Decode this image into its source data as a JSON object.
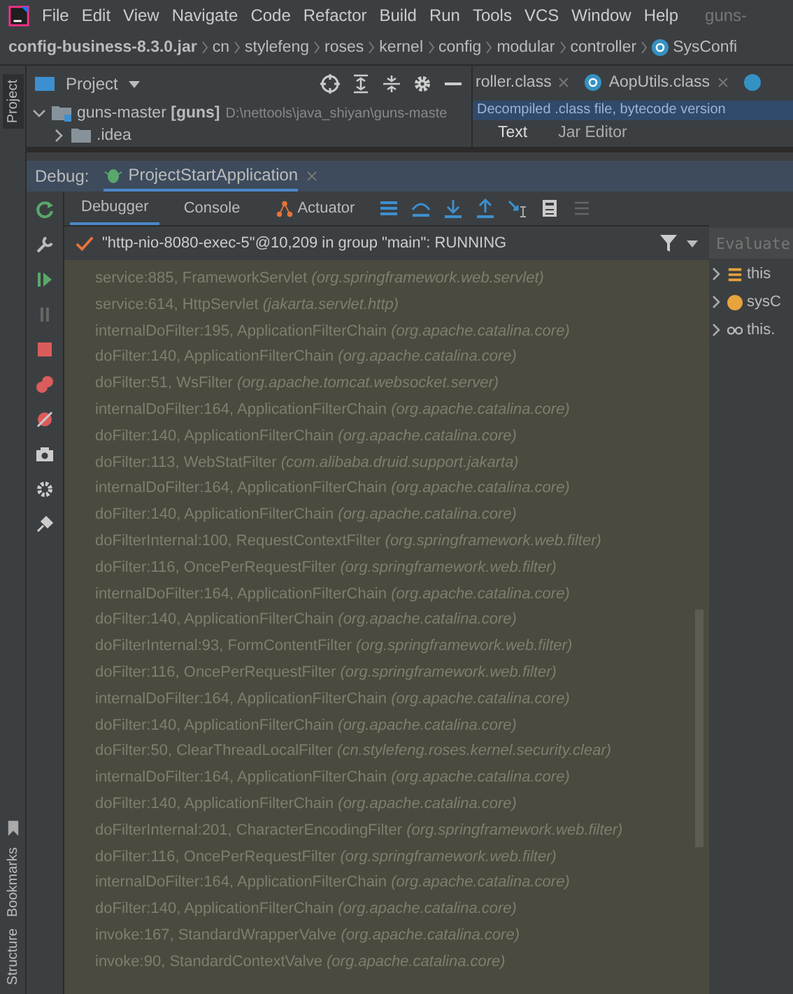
{
  "menu_bar": {
    "items": [
      "File",
      "Edit",
      "View",
      "Navigate",
      "Code",
      "Refactor",
      "Build",
      "Run",
      "Tools",
      "VCS",
      "Window",
      "Help"
    ],
    "title": "guns-"
  },
  "breadcrumb": [
    "config-business-8.3.0.jar",
    "cn",
    "stylefeng",
    "roses",
    "kernel",
    "config",
    "modular",
    "controller",
    "SysConfi"
  ],
  "project_panel": {
    "title": "Project",
    "tree": [
      {
        "name": "guns-master",
        "module": "[guns]",
        "path": "D:\\nettools\\java_shiyan\\guns-maste",
        "expanded": true,
        "children": [
          {
            "name": ".idea",
            "expanded": false
          }
        ]
      }
    ]
  },
  "editor_tabs": [
    "roller.class",
    "AopUtils.class"
  ],
  "editor_banner": "Decompiled .class file, bytecode version",
  "editor_subtabs": [
    {
      "label": "Text",
      "selected": true
    },
    {
      "label": "Jar Editor",
      "selected": false
    }
  ],
  "debug": {
    "label": "Debug:",
    "tabs": [
      {
        "label": "ProjectStartApplication",
        "selected": true
      }
    ],
    "toolbar_tabs": [
      {
        "label": "Debugger",
        "selected": true
      },
      {
        "label": "Console",
        "selected": false
      },
      {
        "label": "Actuator",
        "selected": false
      }
    ],
    "thread": "\"http-nio-8080-exec-5\"@10,209 in group \"main\": RUNNING",
    "evaluate_placeholder": "Evaluate",
    "frames": [
      "service:885, FrameworkServlet *(org.springframework.web.servlet)*",
      "service:614, HttpServlet *(jakarta.servlet.http)*",
      "internalDoFilter:195, ApplicationFilterChain *(org.apache.catalina.core)*",
      "doFilter:140, ApplicationFilterChain *(org.apache.catalina.core)*",
      "doFilter:51, WsFilter *(org.apache.tomcat.websocket.server)*",
      "internalDoFilter:164, ApplicationFilterChain *(org.apache.catalina.core)*",
      "doFilter:140, ApplicationFilterChain *(org.apache.catalina.core)*",
      "doFilter:113, WebStatFilter *(com.alibaba.druid.support.jakarta)*",
      "internalDoFilter:164, ApplicationFilterChain *(org.apache.catalina.core)*",
      "doFilter:140, ApplicationFilterChain *(org.apache.catalina.core)*",
      "doFilterInternal:100, RequestContextFilter *(org.springframework.web.filter)*",
      "doFilter:116, OncePerRequestFilter *(org.springframework.web.filter)*",
      "internalDoFilter:164, ApplicationFilterChain *(org.apache.catalina.core)*",
      "doFilter:140, ApplicationFilterChain *(org.apache.catalina.core)*",
      "doFilterInternal:93, FormContentFilter *(org.springframework.web.filter)*",
      "doFilter:116, OncePerRequestFilter *(org.springframework.web.filter)*",
      "internalDoFilter:164, ApplicationFilterChain *(org.apache.catalina.core)*",
      "doFilter:140, ApplicationFilterChain *(org.apache.catalina.core)*",
      "doFilter:50, ClearThreadLocalFilter *(cn.stylefeng.roses.kernel.security.clear)*",
      "internalDoFilter:164, ApplicationFilterChain *(org.apache.catalina.core)*",
      "doFilter:140, ApplicationFilterChain *(org.apache.catalina.core)*",
      "doFilterInternal:201, CharacterEncodingFilter *(org.springframework.web.filter)*",
      "doFilter:116, OncePerRequestFilter *(org.springframework.web.filter)*",
      "internalDoFilter:164, ApplicationFilterChain *(org.apache.catalina.core)*",
      "doFilter:140, ApplicationFilterChain *(org.apache.catalina.core)*",
      "invoke:167, StandardWrapperValve *(org.apache.catalina.core)*",
      "invoke:90, StandardContextValve *(org.apache.catalina.core)*"
    ],
    "variables": [
      {
        "kind": "field",
        "name": "this"
      },
      {
        "kind": "object",
        "name": "sysC"
      },
      {
        "kind": "watch",
        "name": "this."
      }
    ]
  },
  "side_tabs": {
    "top": [
      {
        "label": "Project",
        "selected": true
      }
    ],
    "bottom": [
      {
        "label": "Bookmarks",
        "selected": false
      },
      {
        "label": "Structure",
        "selected": false
      }
    ]
  }
}
